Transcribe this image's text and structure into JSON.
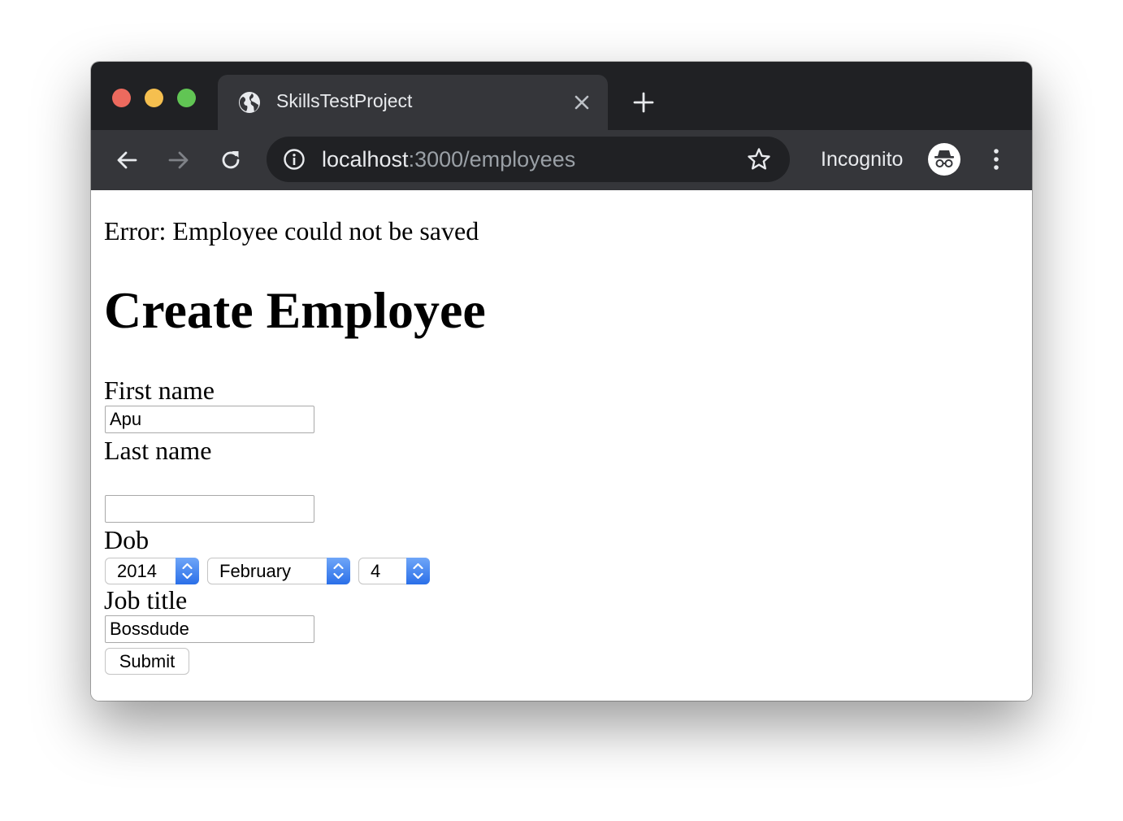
{
  "browser": {
    "tab_title": "SkillsTestProject",
    "url_host": "localhost",
    "url_rest": ":3000/employees",
    "incognito_label": "Incognito"
  },
  "page": {
    "error_message": "Error: Employee could not be saved",
    "title": "Create Employee",
    "form": {
      "first_name_label": "First name",
      "first_name_value": "Apu",
      "last_name_label": "Last name",
      "last_name_value": "",
      "dob_label": "Dob",
      "dob_year": "2014",
      "dob_month": "February",
      "dob_day": "4",
      "job_title_label": "Job title",
      "job_title_value": "Bossdude",
      "submit_label": "Submit"
    }
  },
  "icons": {
    "tab": "globe-icon",
    "tab_close": "close-icon",
    "new_tab": "plus-icon",
    "back": "arrow-left-icon",
    "forward": "arrow-right-icon",
    "reload": "reload-icon",
    "site_info": "info-icon",
    "bookmark": "star-icon",
    "incognito": "incognito-icon",
    "menu": "kebab-menu-icon"
  },
  "colors": {
    "titlebar": "#202124",
    "toolbar": "#35363a",
    "omnibox": "#202124",
    "select_accent": "#2a6fe8"
  }
}
